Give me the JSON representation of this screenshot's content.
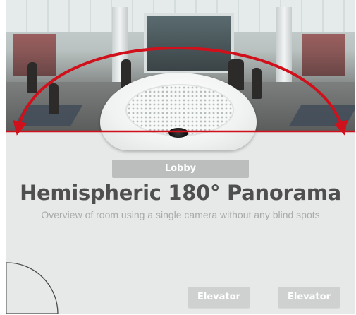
{
  "room_label": "Lobby",
  "title": "Hemispheric 180° Panorama",
  "subtitle": "Overview of room using a single camera without any blind spots",
  "buttons": {
    "elevator_1": "Elevator",
    "elevator_2": "Elevator"
  },
  "colors": {
    "arc": "#d0111b",
    "panel": "#e7e9e9",
    "title": "#4f4f4f",
    "subtitle": "#a9abab",
    "button": "#cfd1d1"
  },
  "icons": {
    "door": "door-swing-icon",
    "camera": "hemispheric-camera-dome"
  }
}
